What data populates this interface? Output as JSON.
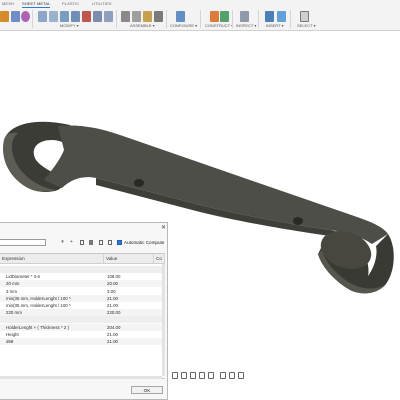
{
  "tabs": [
    {
      "label": "MESH"
    },
    {
      "label": "SHEET METAL"
    },
    {
      "label": "PLASTIC"
    },
    {
      "label": "UTILITIES"
    }
  ],
  "tool_groups": [
    {
      "label": "MODIFY ▾"
    },
    {
      "label": "ASSEMBLE ▾"
    },
    {
      "label": "CONFIGURE ▾"
    },
    {
      "label": "CONSTRUCT ▾"
    },
    {
      "label": "INSPECT ▾"
    },
    {
      "label": "INSERT ▾"
    },
    {
      "label": "SELECT ▾"
    }
  ],
  "dialog": {
    "close_label": "✕",
    "auto_compute_label": "Automatic Compute",
    "auto_compute_checked": true,
    "columns": [
      "Expression",
      "Value",
      "Co"
    ],
    "rows": [
      {
        "expression": "",
        "value": ""
      },
      {
        "expression": "LidDiameter * 0.6",
        "value": "108.00"
      },
      {
        "expression": "20 mm",
        "value": "20.00"
      },
      {
        "expression": "3 mm",
        "value": "3.00"
      },
      {
        "expression": "min(35 mm, HolderLenght / 100 *",
        "value": "21.00"
      },
      {
        "expression": "min(35 mm, HolderLenght / 100 *",
        "value": "21.00"
      },
      {
        "expression": "220 mm",
        "value": "220.00"
      },
      {
        "expression": "",
        "value": ""
      },
      {
        "expression": "HolderLenght + ( Thickness * 2 )",
        "value": "204.00"
      },
      {
        "expression": "Height",
        "value": "21.00"
      },
      {
        "expression": "d68",
        "value": "21.00"
      }
    ],
    "ok_label": "OK"
  },
  "colors": {
    "accent": "#2a7ad6",
    "part_body": "#4e4e48",
    "part_dark": "#35352f"
  },
  "icons": [
    "search-icon",
    "add-parameter-icon",
    "copy-icon",
    "delete-icon",
    "checkbox-icon",
    "close-icon"
  ]
}
